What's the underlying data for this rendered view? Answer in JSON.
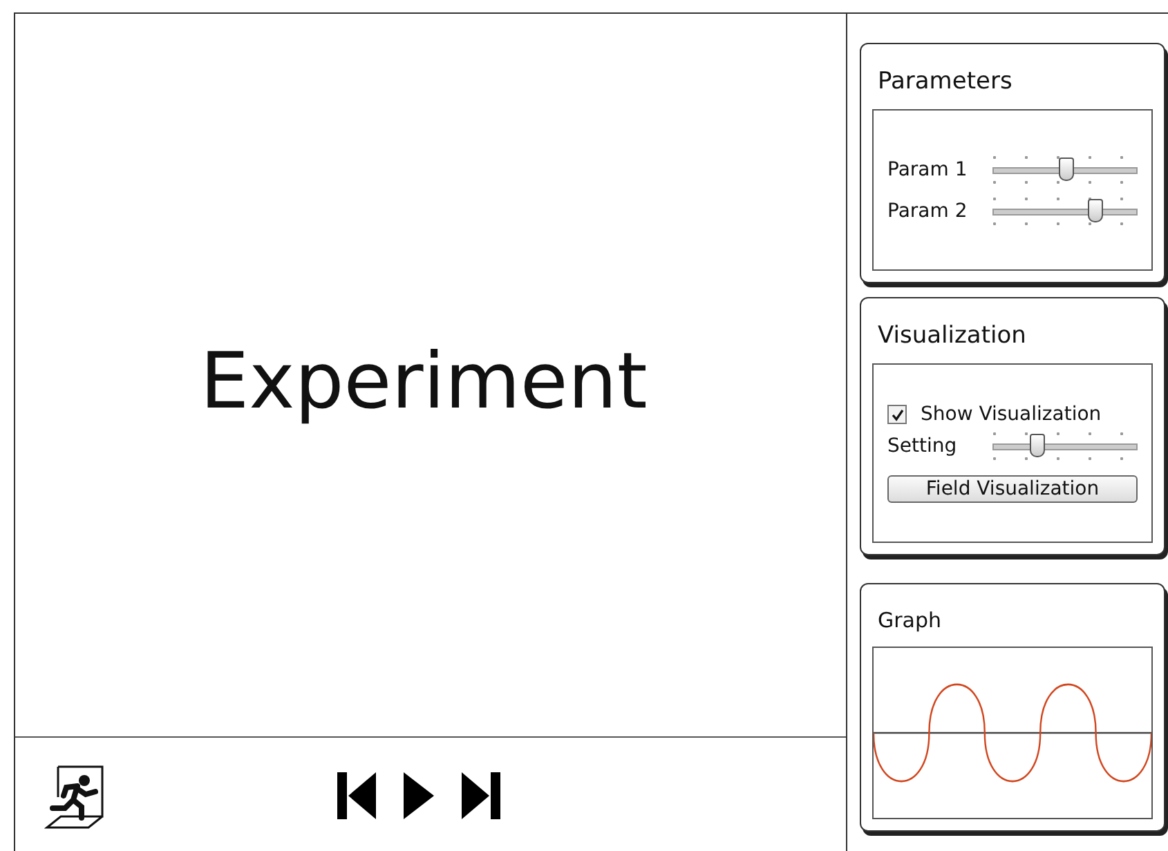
{
  "stage": {
    "title": "Experiment"
  },
  "parameters": {
    "title": "Parameters",
    "sliders": [
      {
        "label": "Param 1",
        "level": 0.5
      },
      {
        "label": "Param 2",
        "level": 0.7
      }
    ]
  },
  "visualization": {
    "title": "Visualization",
    "show": {
      "label": "Show Visualization",
      "checked": true
    },
    "setting": {
      "label": "Setting",
      "level": 0.3
    },
    "button": "Field Visualization"
  },
  "graph": {
    "title": "Graph"
  }
}
